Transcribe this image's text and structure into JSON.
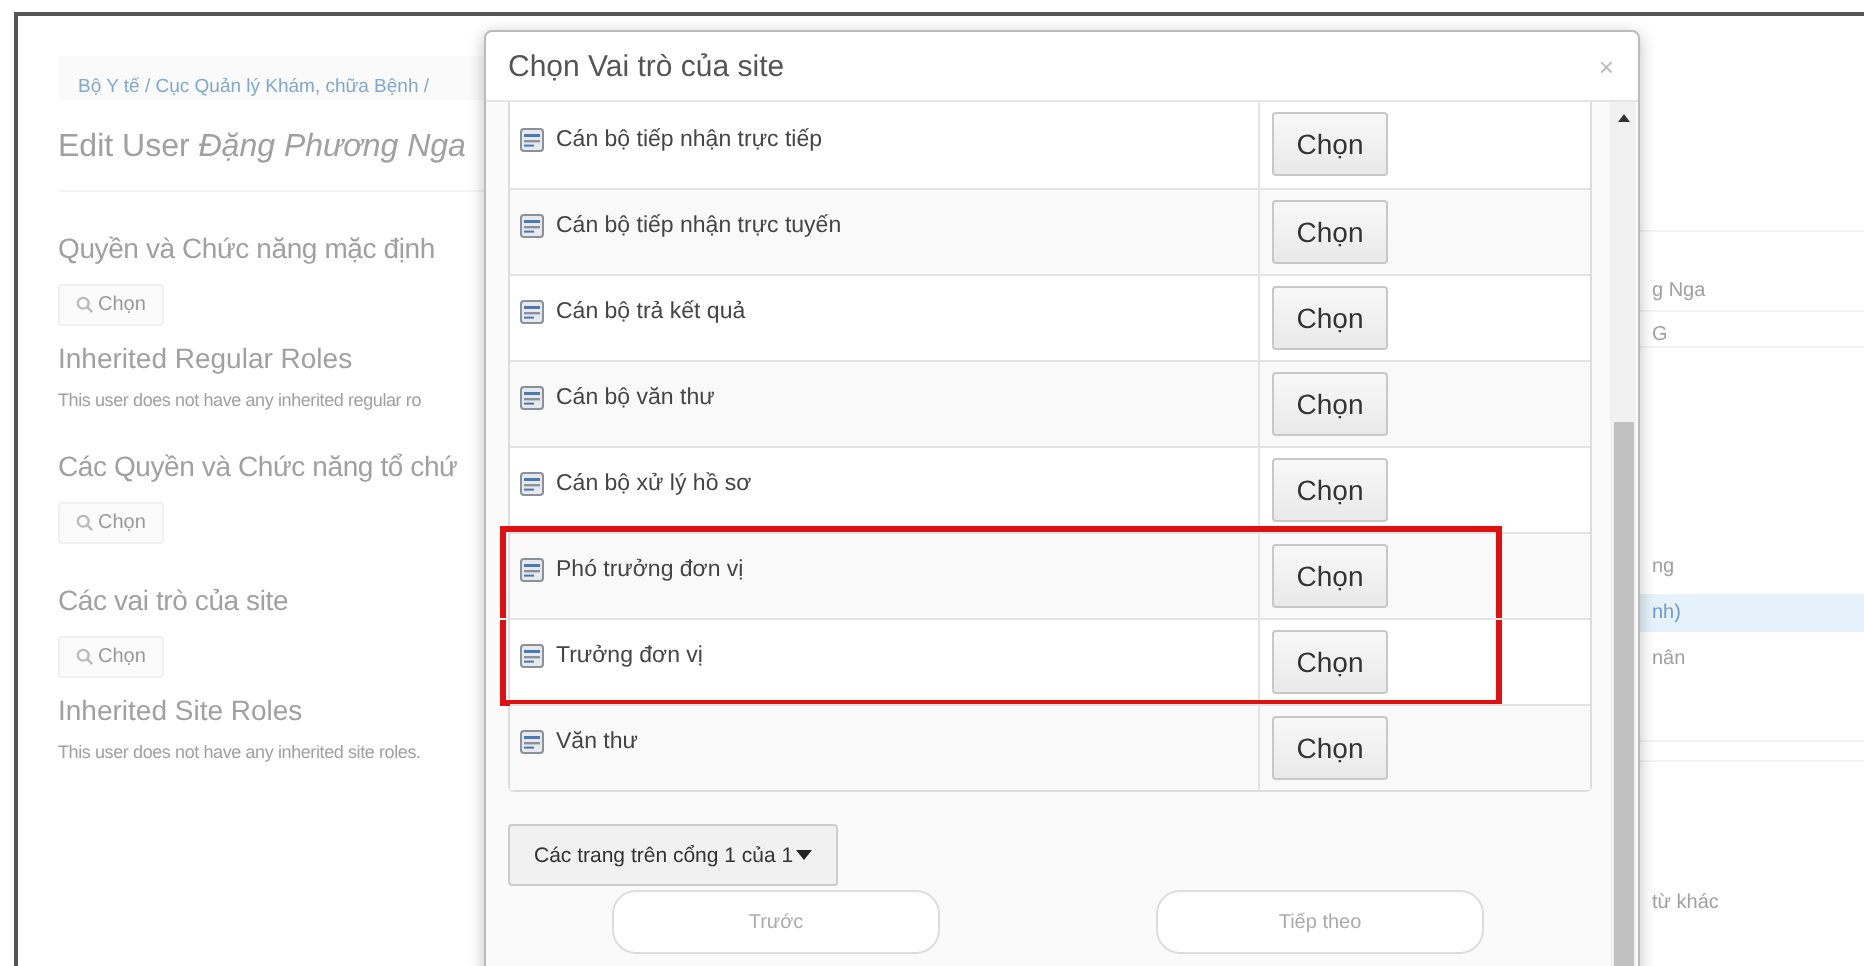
{
  "background": {
    "breadcrumb": "Bộ Y tế / Cục Quản lý Khám, chữa Bệnh /",
    "title_prefix": "Edit User",
    "title_name": "Đặng Phương Nga",
    "sections": [
      {
        "kind": "heading",
        "text": "Quyền và Chức năng mặc định"
      },
      {
        "kind": "button",
        "text": "Chọn"
      },
      {
        "kind": "subheading",
        "text": "Inherited Regular Roles"
      },
      {
        "kind": "note",
        "text": "This user does not have any inherited regular ro"
      },
      {
        "kind": "heading",
        "text": "Các Quyền và Chức năng tổ chứ"
      },
      {
        "kind": "button",
        "text": "Chọn"
      },
      {
        "kind": "heading",
        "text": "Các vai trò của site"
      },
      {
        "kind": "button",
        "text": "Chọn"
      },
      {
        "kind": "subheading",
        "text": "Inherited Site Roles"
      },
      {
        "kind": "note",
        "text": "This user does not have any inherited site roles."
      }
    ],
    "right_fragments": [
      {
        "text": "g Nga",
        "selected": false
      },
      {
        "text": "G",
        "selected": false
      },
      {
        "text": "ng",
        "selected": false
      },
      {
        "text": "nh)",
        "selected": true
      },
      {
        "text": "nân",
        "selected": false
      },
      {
        "text": "từ khác",
        "selected": false
      }
    ]
  },
  "dialog": {
    "title": "Chọn Vai trò của site",
    "close": "×",
    "rows": [
      {
        "name": "Cán bộ tiếp nhận trực tiếp",
        "action": "Chọn",
        "highlighted": false
      },
      {
        "name": "Cán bộ tiếp nhận trực tuyến",
        "action": "Chọn",
        "highlighted": false
      },
      {
        "name": "Cán bộ trả kết quả",
        "action": "Chọn",
        "highlighted": false
      },
      {
        "name": "Cán bộ văn thư",
        "action": "Chọn",
        "highlighted": false
      },
      {
        "name": "Cán bộ xử lý hồ sơ",
        "action": "Chọn",
        "highlighted": false
      },
      {
        "name": "Phó trưởng đơn vị",
        "action": "Chọn",
        "highlighted": true
      },
      {
        "name": "Trưởng đơn vị",
        "action": "Chọn",
        "highlighted": true
      },
      {
        "name": "Văn thư",
        "action": "Chọn",
        "highlighted": false
      }
    ],
    "page_menu": "Các trang trên cổng 1 của 1",
    "prev": "Trước",
    "next": "Tiếp theo"
  }
}
